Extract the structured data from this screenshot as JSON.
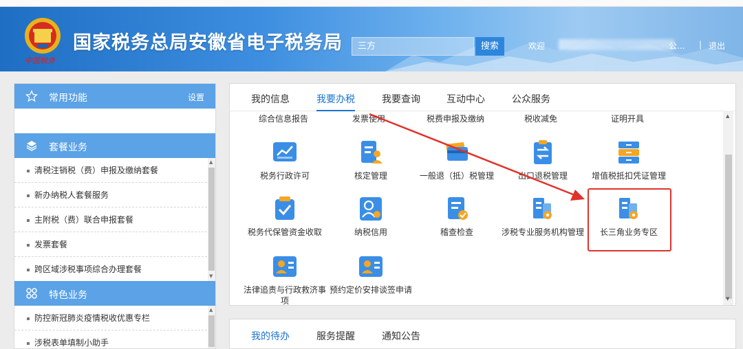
{
  "header": {
    "title": "国家税务总局安徽省电子税务局",
    "emblem_caption": "中国税务",
    "search_value": "三方",
    "search_button": "搜索",
    "welcome": "欢迎",
    "username_suffix": "公...",
    "separator": "|",
    "logout": "退出"
  },
  "left_panel": {
    "common": {
      "label": "常用功能",
      "settings": "设置",
      "icon": "star-icon"
    },
    "package": {
      "label": "套餐业务",
      "icon": "layers-icon",
      "items": [
        "清税注销税（费）申报及缴纳套餐",
        "新办纳税人套餐服务",
        "主附税（费）联合申报套餐",
        "发票套餐",
        "跨区域涉税事项综合办理套餐"
      ]
    },
    "special": {
      "label": "特色业务",
      "icon": "grid-icon",
      "items": [
        "防控新冠肺炎疫情税收优惠专栏",
        "涉税表单填制小助手"
      ]
    }
  },
  "main": {
    "tabs": [
      "我的信息",
      "我要办税",
      "我要查询",
      "互动中心",
      "公众服务"
    ],
    "active_tab": "我要办税",
    "categories": [
      "综合信息报告",
      "发票使用",
      "税费申报及缴纳",
      "税收减免",
      "证明开具"
    ],
    "tiles_row1": [
      {
        "label": "税务行政许可",
        "icon": "chart-icon"
      },
      {
        "label": "核定管理",
        "icon": "document-user-icon"
      },
      {
        "label": "一般退（抵）税管理",
        "icon": "card-icon"
      },
      {
        "label": "出口退税管理",
        "icon": "clipboard-exchange-icon"
      },
      {
        "label": "增值税抵扣凭证管理",
        "icon": "cabinet-icon"
      }
    ],
    "tiles_row2": [
      {
        "label": "税务代保管资金收取",
        "icon": "shield-check-icon"
      },
      {
        "label": "纳税信用",
        "icon": "user-star-icon"
      },
      {
        "label": "稽查检查",
        "icon": "doc-check-icon"
      },
      {
        "label": "涉税专业服务机构管理",
        "icon": "building-gear-icon"
      },
      {
        "label": "长三角业务专区",
        "icon": "building-gear-icon"
      }
    ],
    "tiles_row3": [
      {
        "label": "法律追责与行政救济事项",
        "icon": "id-card-icon"
      },
      {
        "label": "预约定价安排谈签申请",
        "icon": "id-card-icon"
      }
    ]
  },
  "bottom_tabs": [
    "我的待办",
    "服务提醒",
    "通知公告"
  ],
  "colors": {
    "accent": "#1a73d0",
    "section_header": "#5ba2e6",
    "highlight": "#e0322a"
  }
}
